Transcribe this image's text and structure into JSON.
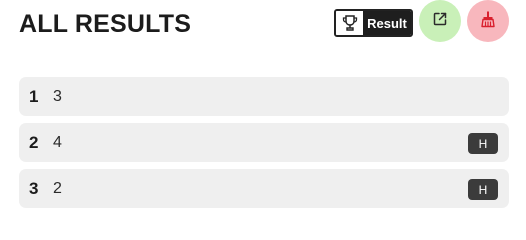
{
  "header": {
    "title": "ALL RESULTS",
    "result_button_label": "Result",
    "result_button_icon": "trophy-icon",
    "share_button_icon": "external-link-icon",
    "clear_button_icon": "broom-icon",
    "share_button_color": "#c9f0b8",
    "clear_button_color": "#f8b7bd"
  },
  "results": [
    {
      "rank": "1",
      "value": "3",
      "tag": ""
    },
    {
      "rank": "2",
      "value": "4",
      "tag": "H"
    },
    {
      "rank": "3",
      "value": "2",
      "tag": "H"
    }
  ]
}
